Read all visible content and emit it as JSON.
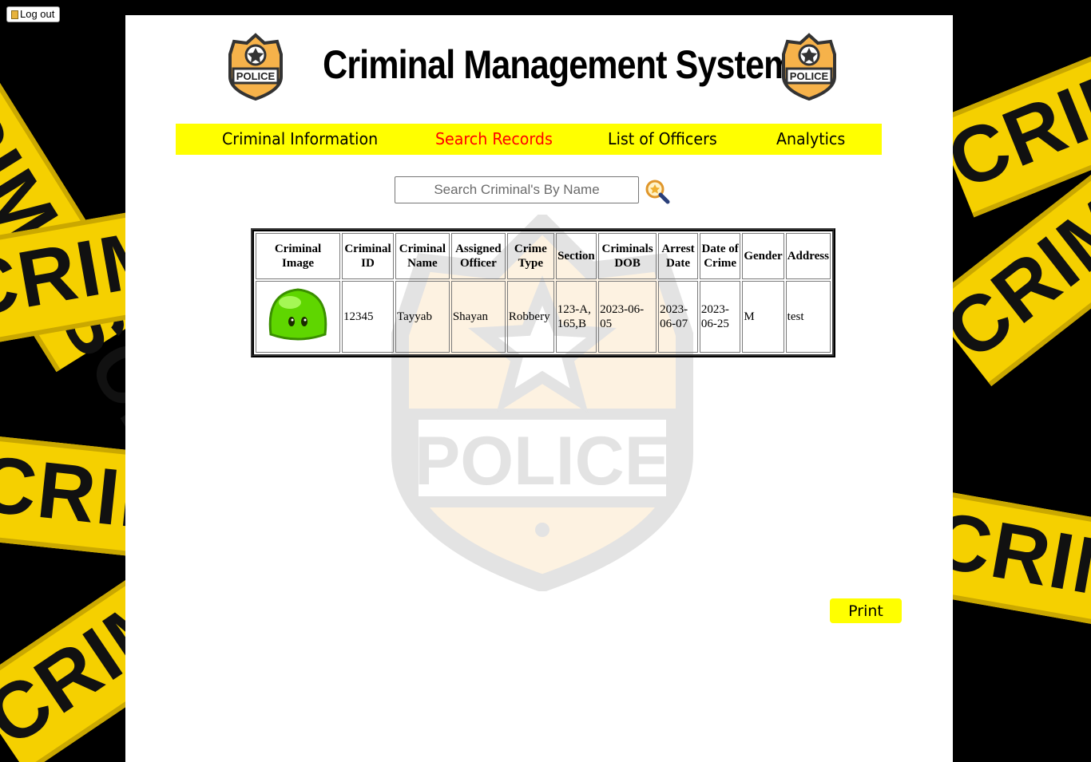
{
  "background": {
    "tape_texts": [
      "CRIME SCENE",
      "CRIME",
      "CRIME",
      "CRIME SCENE",
      "CRIME",
      "CRIME SCENE",
      "CRIME SCENE"
    ]
  },
  "logout": {
    "label": "Log out"
  },
  "header": {
    "title": "Criminal Management System",
    "badge_text": "POLICE"
  },
  "nav": {
    "items": [
      {
        "label": "Criminal Information"
      },
      {
        "label": "Search Records"
      },
      {
        "label": "List of Officers"
      },
      {
        "label": "Analytics"
      }
    ],
    "active": "Search Records"
  },
  "search": {
    "placeholder": "Search Criminal's By Name"
  },
  "table": {
    "headers": [
      "Criminal Image",
      "Criminal ID",
      "Criminal Name",
      "Assigned Officer",
      "Crime Type",
      "Section",
      "Criminals DOB",
      "Arrest Date",
      "Date of Crime",
      "Gender",
      "Address"
    ],
    "rows": [
      {
        "id": "12345",
        "name": "Tayyab",
        "officer": "Shayan",
        "crime_type": "Robbery",
        "section": "123-A, 165,B",
        "dob": "2023-06-05",
        "arrest_date": "2023-06-07",
        "crime_date": "2023-06-25",
        "gender": "M",
        "address": "test"
      }
    ]
  },
  "watermark_text": "POLICE",
  "print": {
    "label": "Print"
  },
  "colors": {
    "nav_bg": "#ffff00",
    "active_link": "#ff0000",
    "tape": "#f5d000"
  }
}
